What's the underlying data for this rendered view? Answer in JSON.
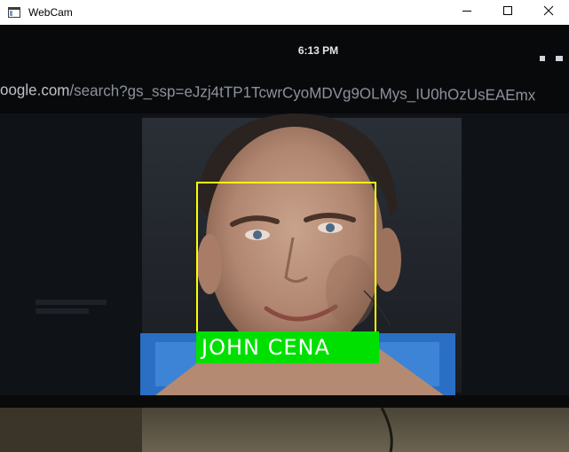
{
  "window": {
    "title": "WebCam",
    "app_icon": "app-window-icon",
    "controls": [
      "minimize-icon",
      "maximize-icon",
      "close-icon"
    ]
  },
  "screen": {
    "clock": "6:13 PM",
    "url_domain": "oogle.com",
    "url_path": "/search?gs_ssp=eJzj4tTP1TcwrCyoMDVg9OLMys_IU0hOzUsEAEmx"
  },
  "detection": {
    "label": "JOHN CENA",
    "box_color": "#ffff00",
    "label_bg_color": "#00e000",
    "label_text_color": "#ffffff"
  }
}
